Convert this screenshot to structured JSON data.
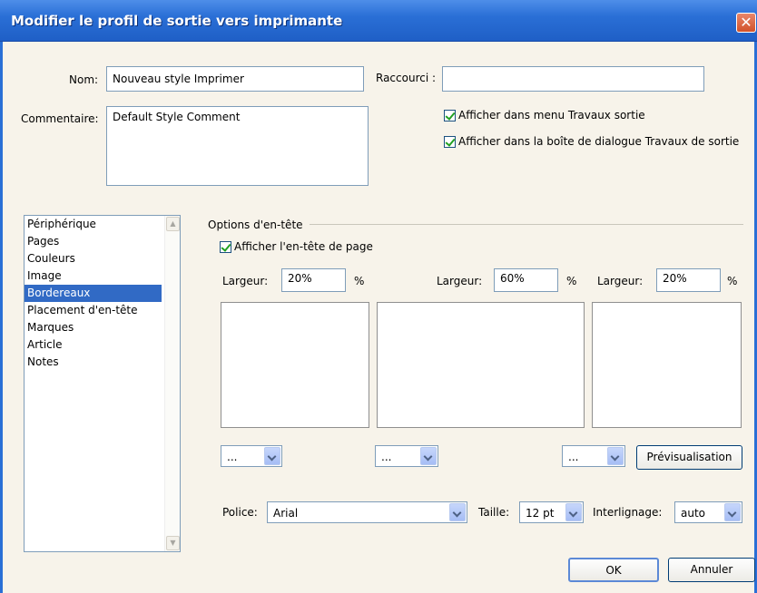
{
  "window": {
    "title": "Modifier le profil de sortie vers imprimante",
    "close_glyph": "✕"
  },
  "form": {
    "name_label": "Nom:",
    "name_value": "Nouveau style Imprimer",
    "shortcut_label": "Raccourci :",
    "shortcut_value": "",
    "comment_label": "Commentaire:",
    "comment_value": "Default Style Comment",
    "check_show_menu": "Afficher dans menu Travaux sortie",
    "check_show_dialog": "Afficher dans la boîte de dialogue Travaux de sortie"
  },
  "sidebar": {
    "items": [
      {
        "label": "Périphérique"
      },
      {
        "label": "Pages"
      },
      {
        "label": "Couleurs"
      },
      {
        "label": "Image"
      },
      {
        "label": "Bordereaux"
      },
      {
        "label": "Placement d'en-tête"
      },
      {
        "label": "Marques"
      },
      {
        "label": "Article"
      },
      {
        "label": "Notes"
      }
    ],
    "selected": "Bordereaux"
  },
  "header_options": {
    "group_label": "Options d'en-tête",
    "show_header_label": "Afficher l'en-tête de page",
    "width_label": "Largeur:",
    "percent": "%",
    "widths": [
      "20%",
      "60%",
      "20%"
    ],
    "combo_values": [
      "...",
      "...",
      "..."
    ],
    "preview_button": "Prévisualisation",
    "font_label": "Police:",
    "font_value": "Arial",
    "size_label": "Taille:",
    "size_value": "12 pt",
    "leading_label": "Interlignage:",
    "leading_value": "auto"
  },
  "footer": {
    "ok": "OK",
    "cancel": "Annuler"
  },
  "colors": {
    "titlebar": "#2a6fd6",
    "selection": "#316ac5",
    "check": "#21a121"
  }
}
